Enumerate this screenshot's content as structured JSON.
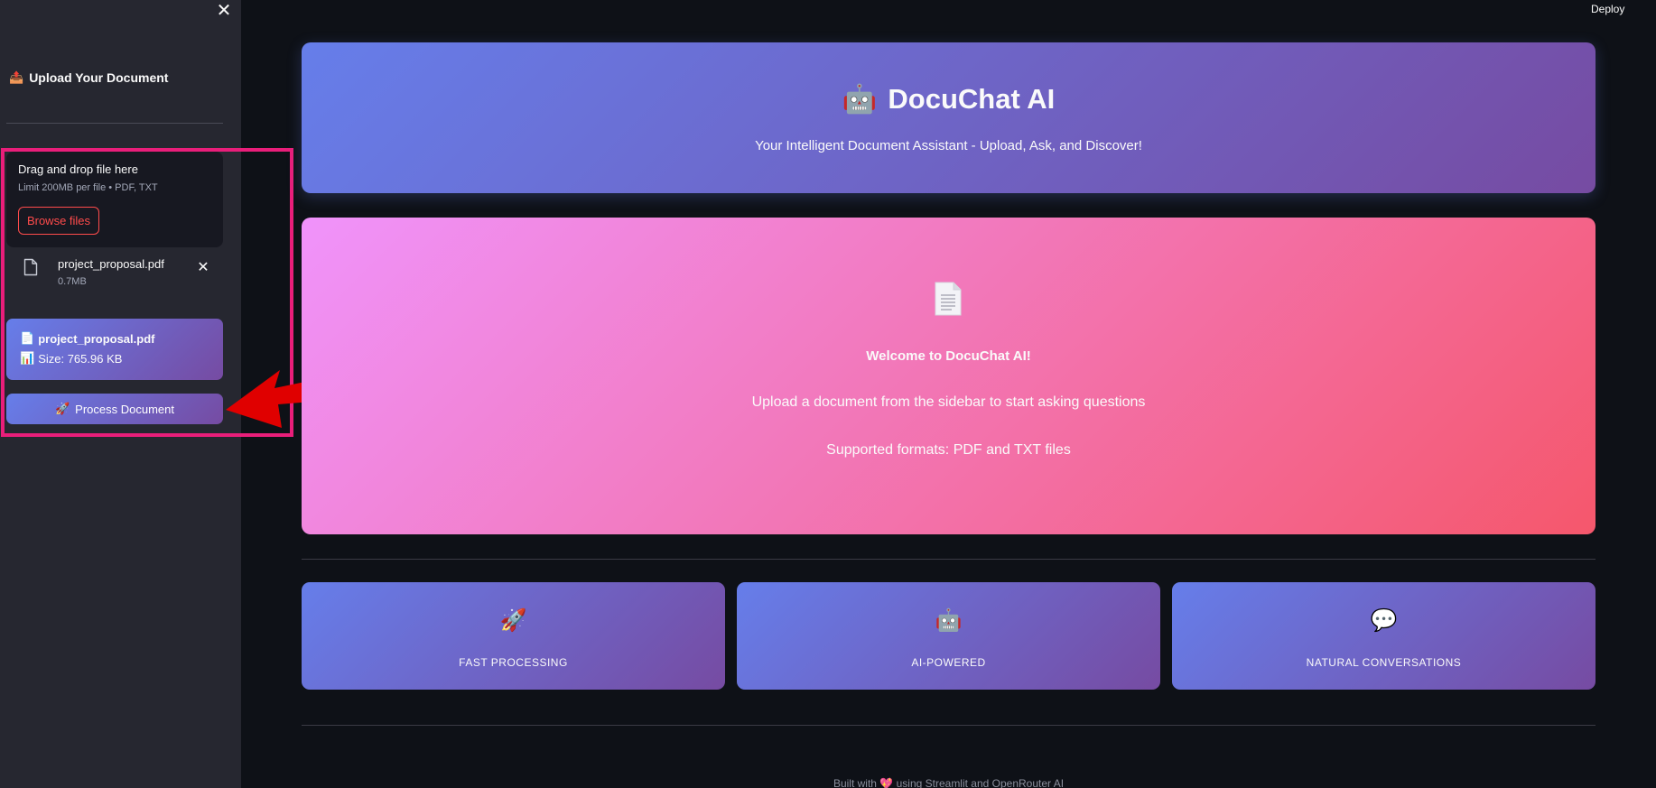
{
  "sidebar": {
    "close_icon": "close-icon",
    "title": "Upload Your Document",
    "title_icon": "📤",
    "uploader": {
      "title": "Drag and drop file here",
      "limit": "Limit 200MB per file • PDF, TXT",
      "browse_label": "Browse files"
    },
    "uploaded_file": {
      "name": "project_proposal.pdf",
      "size": "0.7MB"
    },
    "file_card": {
      "name_icon": "📄",
      "name": "project_proposal.pdf",
      "size_icon": "📊",
      "size": "Size: 765.96 KB"
    },
    "process_button": {
      "icon": "🚀",
      "label": "Process Document"
    }
  },
  "header": {
    "deploy_label": "Deploy"
  },
  "hero": {
    "icon": "🤖",
    "title": "DocuChat AI",
    "subtitle": "Your Intelligent Document Assistant - Upload, Ask, and Discover!"
  },
  "welcome": {
    "icon": "document-icon",
    "title": "Welcome to DocuChat AI!",
    "line1": "Upload a document from the sidebar to start asking questions",
    "line2": "Supported formats: PDF and TXT files"
  },
  "features": [
    {
      "icon": "🚀",
      "label": "FAST PROCESSING"
    },
    {
      "icon": "🤖",
      "label": "AI-POWERED"
    },
    {
      "icon": "💬",
      "label": "NATURAL CONVERSATIONS"
    }
  ],
  "footer": {
    "prefix": "Built with",
    "heart": "💖",
    "suffix": "using Streamlit and OpenRouter AI"
  },
  "colors": {
    "accent_gradient_start": "#667eea",
    "accent_gradient_end": "#764ba2",
    "pink_gradient_start": "#f093fb",
    "pink_gradient_end": "#f5576c",
    "browse_red": "#ff4b4b",
    "annotation_box": "#e91e7a",
    "annotation_arrow": "#e00000"
  }
}
